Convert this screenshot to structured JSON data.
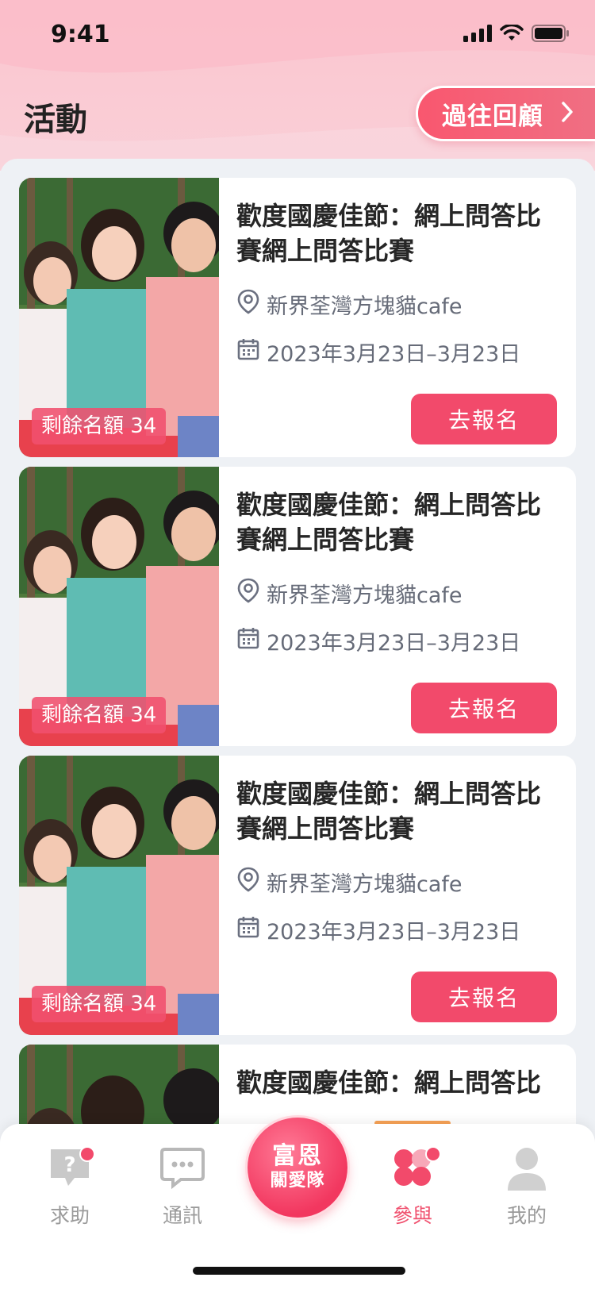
{
  "status": {
    "time": "9:41"
  },
  "header": {
    "title": "活動",
    "history_label": "過往回顧"
  },
  "events": [
    {
      "title": "歡度國慶佳節：網上問答比賽網上問答比賽",
      "quota_label": "剩餘名額 34",
      "location": "新界荃灣方塊貓cafe",
      "date": "2023年3月23日–3月23日",
      "signup_label": "去報名"
    },
    {
      "title": "歡度國慶佳節：網上問答比賽網上問答比賽",
      "quota_label": "剩餘名額 34",
      "location": "新界荃灣方塊貓cafe",
      "date": "2023年3月23日–3月23日",
      "signup_label": "去報名"
    },
    {
      "title": "歡度國慶佳節：網上問答比賽網上問答比賽",
      "quota_label": "剩餘名額 34",
      "location": "新界荃灣方塊貓cafe",
      "date": "2023年3月23日–3月23日",
      "signup_label": "去報名"
    },
    {
      "title": "歡度國慶佳節：網上問答比",
      "quota_label": "",
      "location": "",
      "date": "",
      "signup_label": ""
    }
  ],
  "tabbar": {
    "help": "求助",
    "messages": "通訊",
    "center_line1": "富恩",
    "center_line2": "關愛隊",
    "join": "參與",
    "mine": "我的"
  },
  "colors": {
    "accent": "#f24a6b",
    "header_bg": "#fbc5cf",
    "active_indicator": "#f7a256"
  }
}
